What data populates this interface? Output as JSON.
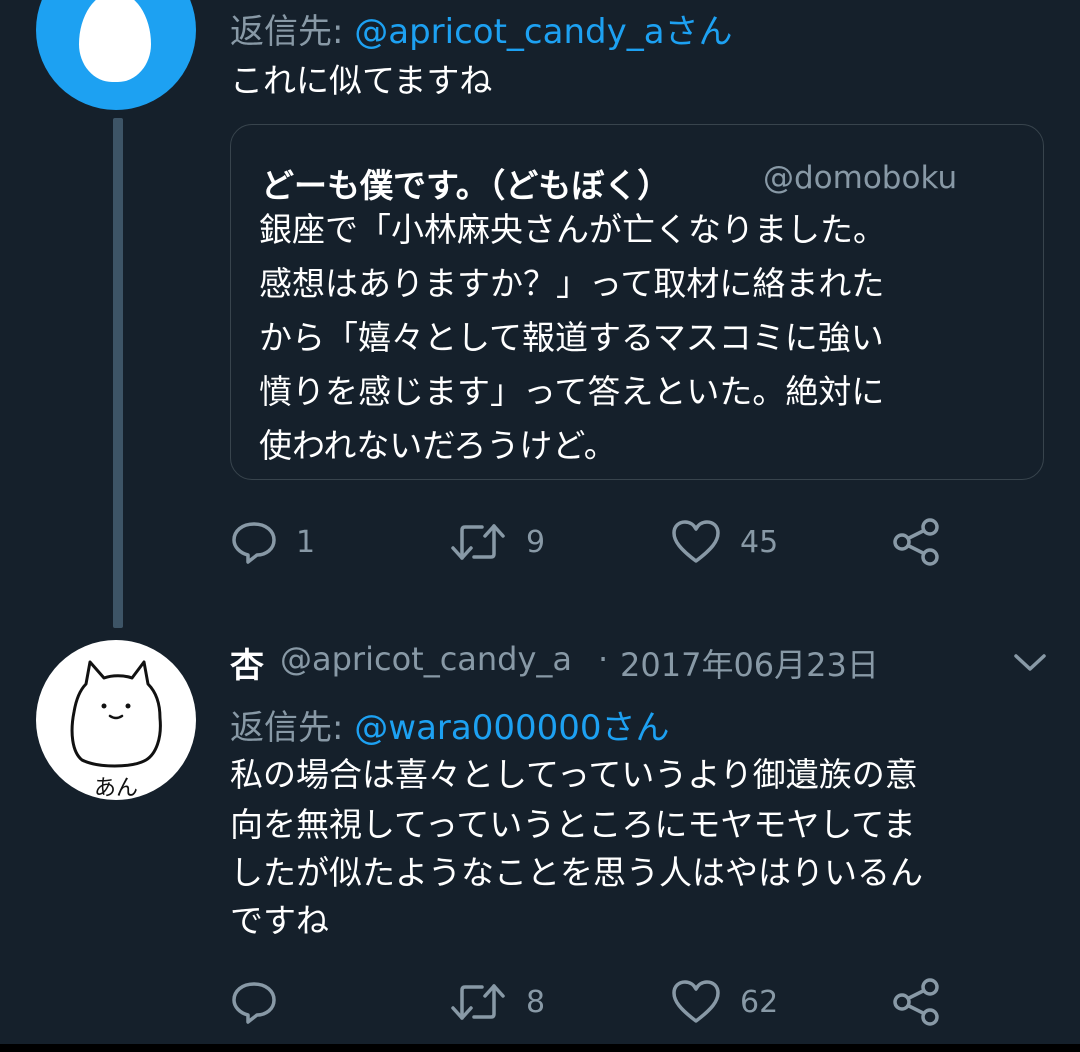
{
  "tweet1": {
    "reply_prefix": "返信先: ",
    "reply_handle": "@apricot_candy_aさん",
    "text": "これに似てますね",
    "quote": {
      "name": "どーも僕です。（どもぼく）",
      "handle": "@domoboku",
      "text": "銀座で「小林麻央さんが亡くなりました。\n感想はありますか？」って取材に絡まれた\nから「嬉々として報道するマスコミに強い\n憤りを感じます」って答えといた。絶対に\n使われないだろうけど。"
    },
    "actions": {
      "replies": "1",
      "retweets": "9",
      "likes": "45"
    }
  },
  "tweet2": {
    "avatar_caption": "あん",
    "name": "杏",
    "handle": "@apricot_candy_a",
    "separator": "·",
    "date": "2017年06月23日",
    "reply_prefix": "返信先: ",
    "reply_handle": "@wara000000さん",
    "text_lines": [
      "私の場合は喜々としてっていうより御遺族の意",
      "向を無視してっていうところにモヤモヤしてま",
      "したが似たようなことを思う人はやはりいるん",
      "ですね"
    ],
    "actions": {
      "replies": "",
      "retweets": "8",
      "likes": "62"
    }
  },
  "colors": {
    "background": "#15202b",
    "accent": "#1da1f2",
    "secondary_text": "#8899a6",
    "border": "#38444d"
  },
  "icons": [
    "egg-avatar",
    "cat-avatar",
    "reply-icon",
    "retweet-icon",
    "like-icon",
    "share-icon",
    "chevron-down-icon"
  ]
}
